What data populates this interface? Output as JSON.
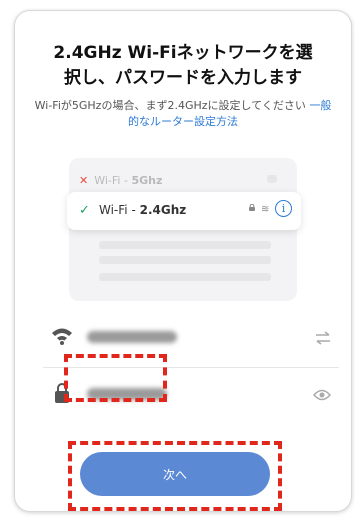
{
  "header": {
    "title_line1": "2.4GHz Wi-Fiネットワークを選",
    "title_line2": "択し、パスワードを入力します"
  },
  "subtitle": {
    "text": "Wi-Fiが5GHzの場合、まず2.4GHzに設定してください",
    "link": "一般的なルーター設定方法"
  },
  "illustration": {
    "bad_network_prefix": "Wi-Fi - ",
    "bad_network_band": "5Ghz",
    "good_network_prefix": "Wi-Fi - ",
    "good_network_band": "2.4Ghz"
  },
  "form": {
    "ssid_value": "",
    "password_value": ""
  },
  "next_button": {
    "label": "次へ"
  },
  "colors": {
    "accent": "#5b89d4",
    "link": "#2e7bd6",
    "highlight": "#e1261c",
    "ok": "#1da462",
    "error": "#e84b3c"
  },
  "icons": {
    "wifi": "wifi-icon",
    "lock": "lock-icon",
    "swap": "swap-icon",
    "eye": "eye-icon",
    "info": "info-icon",
    "check": "check-icon",
    "cross": "cross-icon"
  }
}
